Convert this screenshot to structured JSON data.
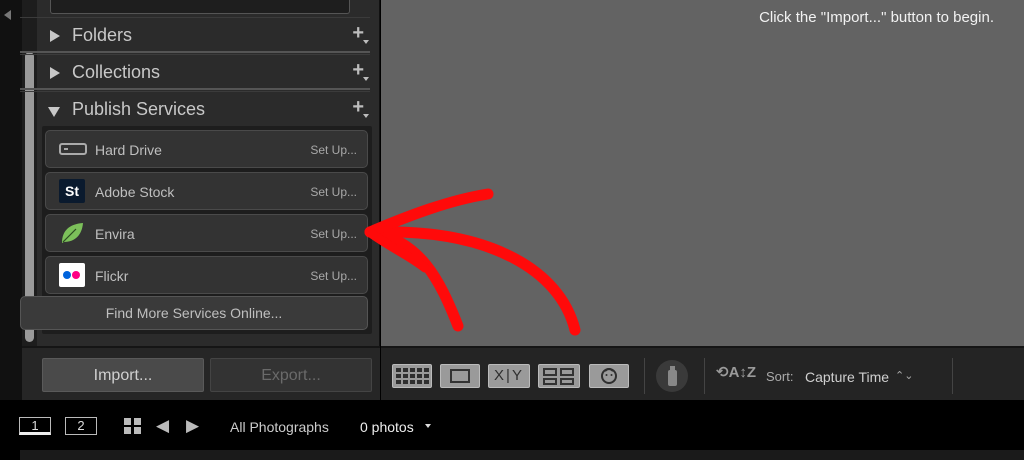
{
  "left_panel": {
    "sections": [
      {
        "title": "Folders",
        "expanded": false
      },
      {
        "title": "Collections",
        "expanded": false
      },
      {
        "title": "Publish Services",
        "expanded": true
      }
    ],
    "publish_services": [
      {
        "label": "Hard Drive",
        "action": "Set Up...",
        "icon": "hard-drive-icon"
      },
      {
        "label": "Adobe Stock",
        "action": "Set Up...",
        "icon": "adobe-stock-icon",
        "icon_text": "St"
      },
      {
        "label": "Envira",
        "action": "Set Up...",
        "icon": "envira-leaf-icon"
      },
      {
        "label": "Flickr",
        "action": "Set Up...",
        "icon": "flickr-icon"
      }
    ],
    "find_more": "Find More Services Online...",
    "import_label": "Import...",
    "export_label": "Export..."
  },
  "main": {
    "hint": "Click the \"Import...\" button to begin."
  },
  "toolbar": {
    "view_buttons": [
      "grid-view",
      "loupe-view",
      "compare-view",
      "survey-view",
      "people-view"
    ],
    "compare_text": "X|Y",
    "sort_label": "Sort:",
    "sort_value": "Capture Time",
    "sort_caret": "⌃⌄"
  },
  "filmstrip": {
    "monitor_1": "1",
    "monitor_2": "2",
    "source": "All Photographs",
    "count": "0 photos"
  },
  "colors": {
    "main_bg": "#636363",
    "panel_bg": "#2b2b2b",
    "annotation_arrow": "#ff0000",
    "flickr_blue": "#0063dc",
    "flickr_pink": "#ff0084",
    "envira_green": "#7cc05a"
  }
}
